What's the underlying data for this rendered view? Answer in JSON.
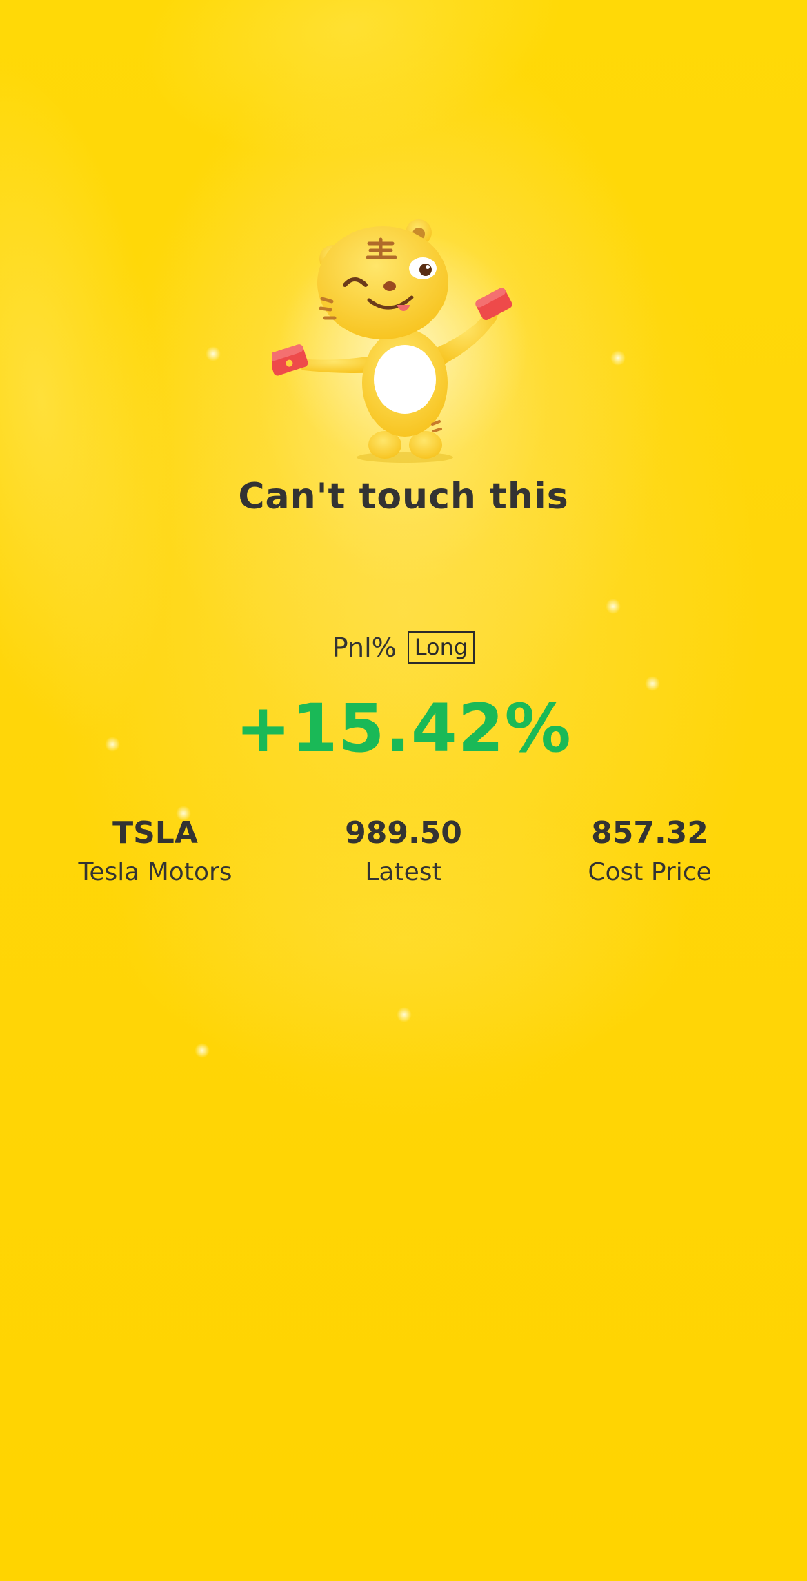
{
  "headline": "Can't touch this",
  "pnl": {
    "label": "Pnl%",
    "direction": "Long",
    "value": "+15.42%",
    "value_color": "#1ab957"
  },
  "stats": [
    {
      "value": "TSLA",
      "label": "Tesla Motors"
    },
    {
      "value": "989.50",
      "label": "Latest"
    },
    {
      "value": "857.32",
      "label": "Cost Price"
    }
  ],
  "colors": {
    "background": "#ffd60a",
    "text": "#333333",
    "gain": "#1ab957"
  },
  "mascot": "tiger-mascot"
}
